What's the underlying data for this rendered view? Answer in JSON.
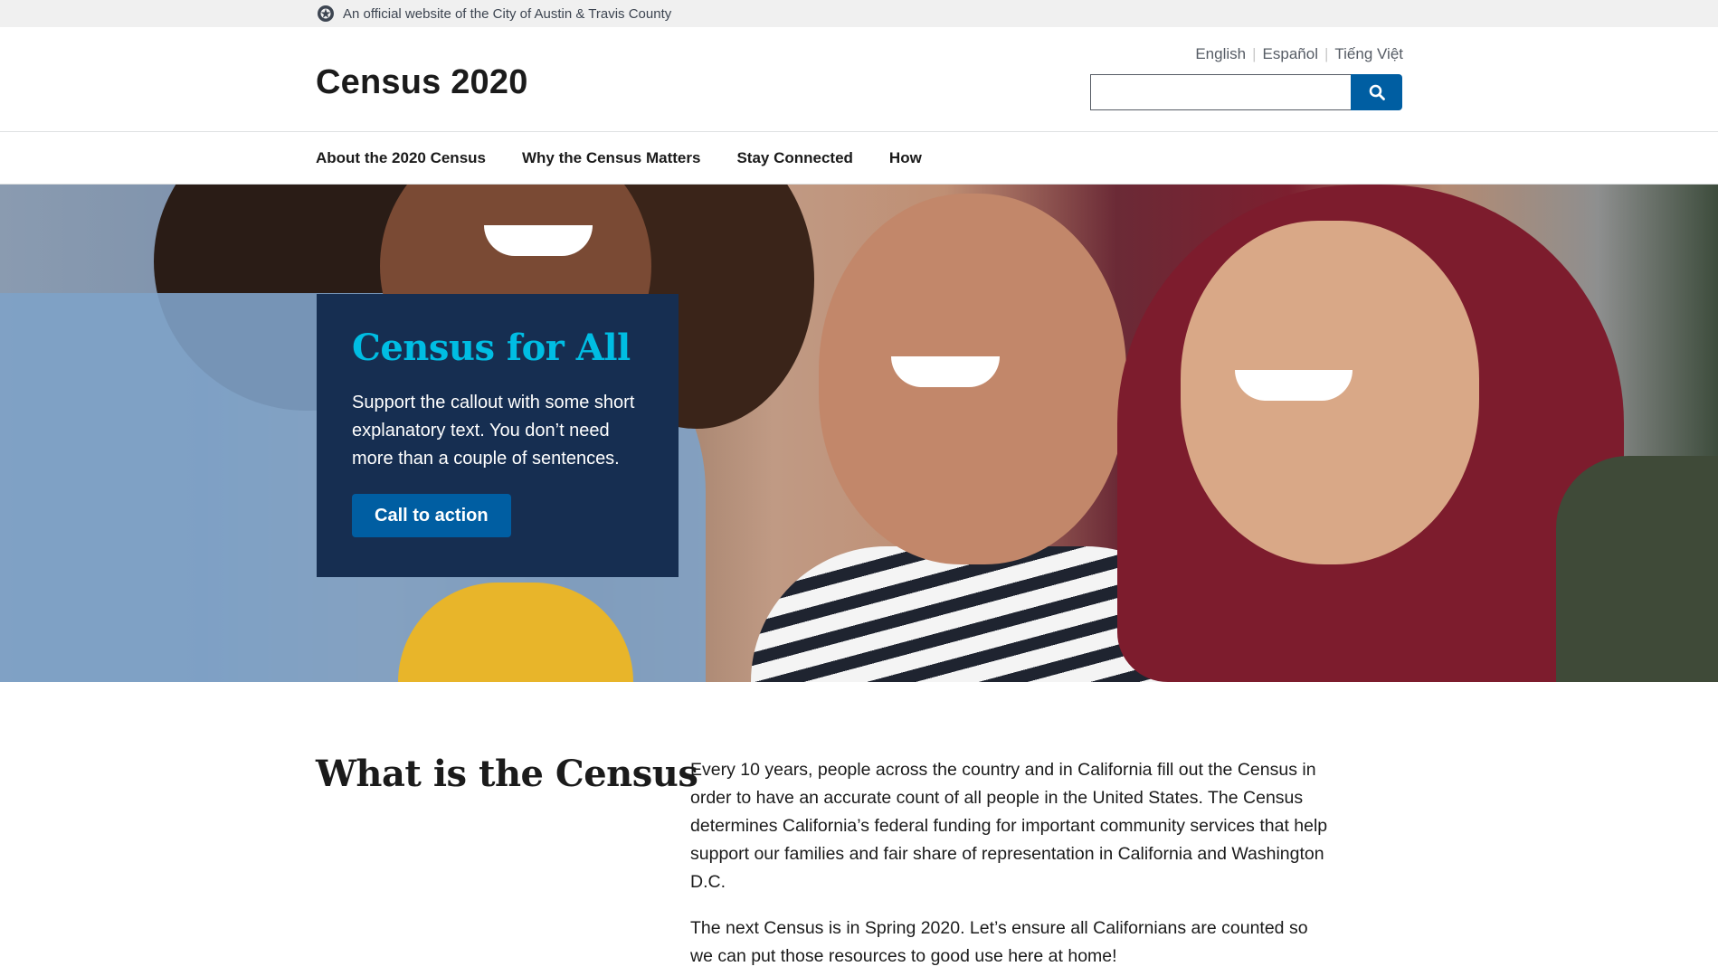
{
  "banner": {
    "text": "An official website of the City of Austin & Travis County"
  },
  "header": {
    "site_title": "Census 2020",
    "languages": [
      "English",
      "Español",
      "Tiếng Việt"
    ],
    "search": {
      "value": "",
      "placeholder": ""
    }
  },
  "nav": {
    "items": [
      "About the 2020 Census",
      "Why the Census Matters",
      "Stay Connected",
      "How"
    ]
  },
  "hero": {
    "callout_title": "Census for All",
    "callout_text": "Support the callout with some short explanatory text. You don’t need more than a couple of sentences.",
    "cta_label": "Call to action"
  },
  "intro": {
    "heading": "What is the Census",
    "paragraphs": [
      "Every 10 years, people across the country and in California fill out the Census in order to have an accurate count of all people in the United States. The Census determines California’s federal funding for important community services that help support our families and fair share of representation in California and Washington D.C.",
      "The next Census is in Spring 2020. Let’s ensure all Californians are counted so we can put those resources to good use here at home!"
    ]
  },
  "colors": {
    "primary": "#005ea2",
    "callout_bg": "#162e51",
    "callout_title": "#00bde3",
    "banner_bg": "#f0f0f0"
  },
  "icons": {
    "seal": "city-seal-icon",
    "search": "search-icon"
  }
}
